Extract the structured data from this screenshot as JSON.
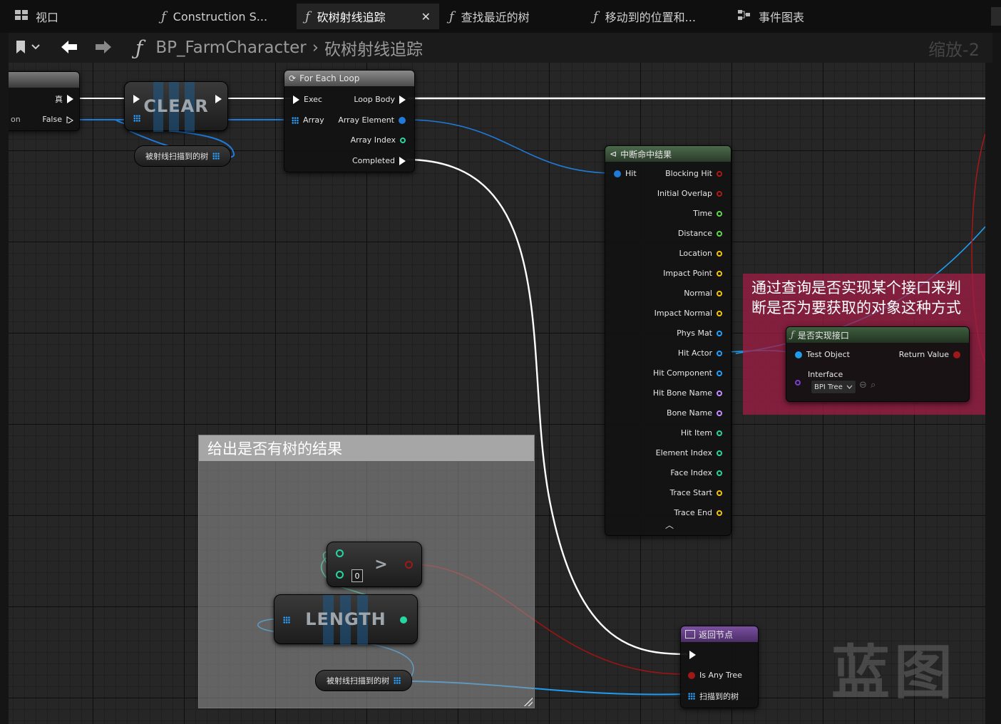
{
  "tabs": [
    {
      "label": "视口",
      "icon": "viewport-icon",
      "active": false
    },
    {
      "label": "Construction S...",
      "icon": "function-icon",
      "active": false
    },
    {
      "label": "砍树射线追踪",
      "icon": "function-icon",
      "active": true
    },
    {
      "label": "查找最近的树",
      "icon": "function-icon",
      "active": false
    },
    {
      "label": "移动到的位置和...",
      "icon": "function-icon",
      "active": false
    },
    {
      "label": "事件图表",
      "icon": "event-graph-icon",
      "active": false
    }
  ],
  "breadcrumb": {
    "root": "BP_FarmCharacter",
    "current": "砍树射线追踪",
    "separator": "›"
  },
  "zoom_label": "缩放-2",
  "branch_node": {
    "true_label": "真",
    "false_label": "False",
    "partial_label": "on"
  },
  "clear_node": {
    "title": "CLEAR"
  },
  "getvar_top": {
    "label": "被射线扫描到的树"
  },
  "foreach_node": {
    "title": "For Each Loop",
    "exec": "Exec",
    "array": "Array",
    "loop_body": "Loop Body",
    "array_element": "Array Element",
    "array_index": "Array Index",
    "completed": "Completed"
  },
  "break_hit": {
    "title": "中断命中结果",
    "input": "Hit",
    "outputs": [
      {
        "label": "Blocking Hit",
        "color": "#b01818"
      },
      {
        "label": "Initial Overlap",
        "color": "#b01818"
      },
      {
        "label": "Time",
        "color": "#5fd84a"
      },
      {
        "label": "Distance",
        "color": "#5fd84a"
      },
      {
        "label": "Location",
        "color": "#f5c400"
      },
      {
        "label": "Impact Point",
        "color": "#f5c400"
      },
      {
        "label": "Normal",
        "color": "#f5c400"
      },
      {
        "label": "Impact Normal",
        "color": "#f5c400"
      },
      {
        "label": "Phys Mat",
        "color": "#1fa0ff"
      },
      {
        "label": "Hit Actor",
        "color": "#1fa0ff"
      },
      {
        "label": "Hit Component",
        "color": "#1fa0ff"
      },
      {
        "label": "Hit Bone Name",
        "color": "#c58bff"
      },
      {
        "label": "Bone Name",
        "color": "#c58bff"
      },
      {
        "label": "Hit Item",
        "color": "#26d6a0"
      },
      {
        "label": "Element Index",
        "color": "#26d6a0"
      },
      {
        "label": "Face Index",
        "color": "#26d6a0"
      },
      {
        "label": "Trace Start",
        "color": "#f5c400"
      },
      {
        "label": "Trace End",
        "color": "#f5c400"
      }
    ]
  },
  "comment_red": {
    "text_line1": "通过查询是否实现某个接口来判",
    "text_line2": "断是否为要获取的对象这种方式"
  },
  "implements_node": {
    "title": "是否实现接口",
    "test_object": "Test Object",
    "return_value": "Return Value",
    "interface_label": "Interface",
    "interface_value": "BPI Tree"
  },
  "comment_gray": {
    "title": "给出是否有树的结果"
  },
  "compare_node": {
    "symbol": ">",
    "value": "0"
  },
  "length_node": {
    "title": "LENGTH"
  },
  "getvar_bottom": {
    "label": "被射线扫描到的树"
  },
  "return_node": {
    "title": "返回节点",
    "is_any_tree": "Is Any Tree",
    "scanned": "扫描到的树"
  },
  "watermark": "蓝图",
  "colors": {
    "exec": "#ffffff",
    "object": "#1fa0ff",
    "bool": "#b01818",
    "int": "#26d6a0",
    "array_header": "#7a4f9a"
  }
}
